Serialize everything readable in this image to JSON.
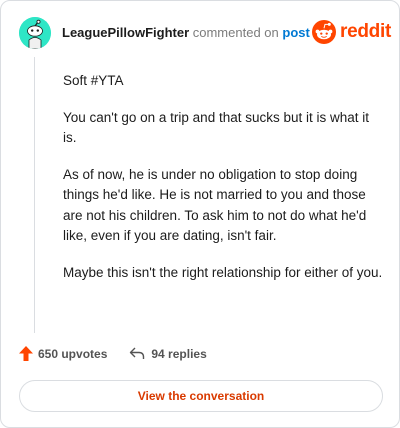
{
  "comment": {
    "author": "LeaguePillowFighter",
    "commented_on": "commented on",
    "post_link": "post",
    "paragraphs": [
      "Soft #YTA",
      "You can't go on a trip and that sucks but it is what it is.",
      "As of now, he is under no obligation to stop doing things he'd like. He is not married to you and those are not his children. To ask him to not do what he'd like, even if you are dating, isn't fair.",
      "Maybe this isn't the right relationship for either of you."
    ]
  },
  "brand": {
    "wordmark": "reddit",
    "color": "#ff4500"
  },
  "stats": {
    "upvotes": "650 upvotes",
    "replies": "94 replies"
  },
  "cta": {
    "label": "View the conversation"
  },
  "icons": {
    "avatar": "snoo-avatar-icon",
    "logo": "reddit-logo-icon",
    "upvote": "upvote-arrow-icon",
    "reply": "reply-arrow-icon"
  },
  "colors": {
    "accent": "#ff4500",
    "link": "#0079d3",
    "avatar_bg": "#2ee6c6",
    "button_text": "#d93a00"
  }
}
